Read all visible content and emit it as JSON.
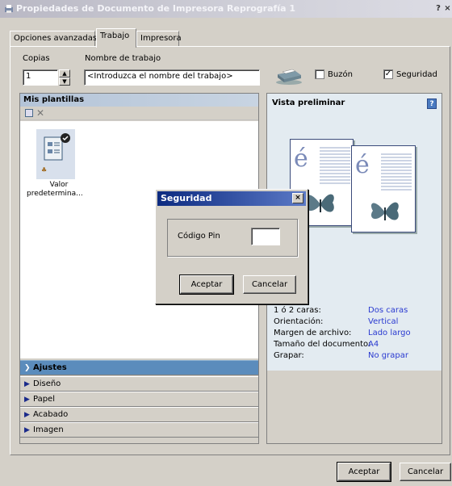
{
  "window": {
    "title": "Propiedades de Documento de Impresora Reprografía 1",
    "help_label": "?",
    "close_label": "×"
  },
  "tabs": [
    {
      "label": "Opciones avanzadas"
    },
    {
      "label": "Trabajo"
    },
    {
      "label": "Impresora"
    }
  ],
  "job": {
    "copies_label": "Copias",
    "copies_value": "1",
    "job_name_label": "Nombre de trabajo",
    "job_name_value": "<Introduzca el nombre del trabajo>",
    "mailbox_label": "Buzón",
    "mailbox_checked": false,
    "security_label": "Seguridad",
    "security_checked": true
  },
  "templates": {
    "header": "Mis plantillas",
    "item_label_line1": "Valor",
    "item_label_line2": "predetermina..."
  },
  "accordion": [
    {
      "label": "Ajustes",
      "expanded": true
    },
    {
      "label": "Diseño"
    },
    {
      "label": "Papel"
    },
    {
      "label": "Acabado"
    },
    {
      "label": "Imagen"
    }
  ],
  "preview": {
    "header": "Vista preliminar",
    "help_label": "?",
    "page_glyph": "é",
    "properties": [
      {
        "key": "1 ó 2 caras:",
        "value": "Dos caras"
      },
      {
        "key": "Orientación:",
        "value": "Vertical"
      },
      {
        "key": "Margen de archivo:",
        "value": "Lado largo"
      },
      {
        "key": "Tamaño del documento:",
        "value": "A4"
      },
      {
        "key": "Grapar:",
        "value": "No grapar"
      }
    ]
  },
  "dialog": {
    "title": "Seguridad",
    "close_label": "×",
    "pin_label": "Código Pin",
    "pin_value": "",
    "ok_label": "Aceptar",
    "cancel_label": "Cancelar"
  },
  "footer": {
    "ok_label": "Aceptar",
    "cancel_label": "Cancelar"
  },
  "colors": {
    "accent_blue": "#2a3ad0",
    "dialog_title": "#0c2a80"
  }
}
